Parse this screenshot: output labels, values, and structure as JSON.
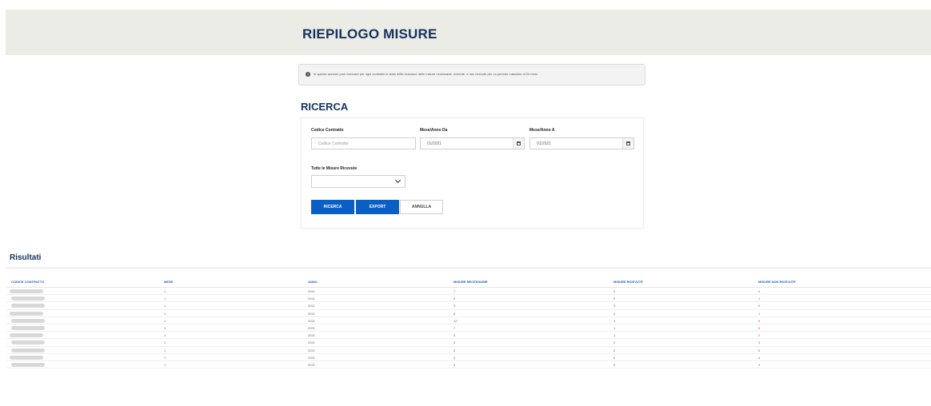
{
  "header": {
    "title": "RIEPILOGO MISURE"
  },
  "info": {
    "text": "In questa sezione puoi ricercare per ogni contratto lo stato della ricezione delle misure necessarie, ricevute, e non ricevute per un periodo massimo di 24 mesi."
  },
  "search": {
    "title": "RICERCA",
    "codice_label": "Codice Contratto",
    "codice_placeholder": "Codice Contratto",
    "da_label": "Mese/Anno Da",
    "da_value": "01/2021",
    "a_label": "Mese/Anno A",
    "a_value": "01/2021",
    "misure_label": "Tutte le Misure Ricevute",
    "misure_value": "",
    "btn_ricerca": "RICERCA",
    "btn_export": "EXPORT",
    "btn_annulla": "ANNULLA"
  },
  "results": {
    "title": "Risultati",
    "columns": [
      "CODICE CONTRATTO",
      "MESE",
      "ANNO",
      "MISURE NECESSARIE",
      "MISURE RICEVUTE",
      "MISURE NON RICEVUTE"
    ],
    "rows": [
      [
        "",
        "1",
        "2021",
        "7",
        "3",
        "4"
      ],
      [
        "",
        "1",
        "2021",
        "3",
        "2",
        "1"
      ],
      [
        "",
        "1",
        "2021",
        "3",
        "3",
        "0"
      ],
      [
        "",
        "1",
        "2021",
        "5",
        "4",
        "1"
      ],
      [
        "",
        "1",
        "2021",
        "12",
        "3",
        "9"
      ],
      [
        "",
        "1",
        "2021",
        "7",
        "1",
        "6"
      ],
      [
        "",
        "1",
        "2021",
        "3",
        "1",
        "2"
      ],
      [
        "",
        "1",
        "2021",
        "3",
        "0",
        "3"
      ],
      [
        "",
        "1",
        "2021",
        "3",
        "3",
        "0"
      ],
      [
        "",
        "1",
        "2021",
        "4",
        "0",
        "4"
      ],
      [
        "",
        "1",
        "2021",
        "4",
        "0",
        "4"
      ]
    ]
  },
  "colors": {
    "primary": "#0a5fc6",
    "title": "#17325c",
    "header_bg": "#ebece6",
    "negative": "#e2343f"
  }
}
